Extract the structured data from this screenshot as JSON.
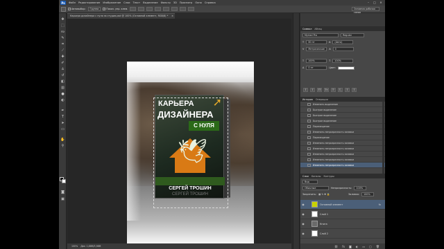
{
  "app": {
    "logo": "Ps"
  },
  "menu": [
    "Файл",
    "Редактирование",
    "Изображение",
    "Слои",
    "Текст",
    "Выделение",
    "Фильтр",
    "3D",
    "Просмотр",
    "Окно",
    "Справка"
  ],
  "window_controls": [
    "–",
    "□",
    "✕"
  ],
  "options": {
    "auto_select": "Автовыбор:",
    "auto_select_target": "Группа",
    "show_transform": "Показ. упр. элем.",
    "workspace": "Основная рабочая среда"
  },
  "document": {
    "tab_title": "Карьера дизайнера с нуля за студии.psd @ 100% (Основной элемент, RGB/8) *",
    "close": "×",
    "status": "100%",
    "status_doc": "Док: 1,88M/3,98M"
  },
  "book": {
    "title_line1": "КАРЬЕРА",
    "title_line2": "ДИЗАЙНЕРА",
    "subtitle": "С НУЛЯ",
    "author": "СЕРГЕЙ ТРОШИН",
    "author_mirror": "СЕРГЕЙ ТРОШИН"
  },
  "character_panel": {
    "tabs": [
      "Символ",
      "Абзац"
    ],
    "font": "Myriad Pro",
    "style": "Regular",
    "size": "30 пт",
    "leading": "(Авто)",
    "kerning": "Метрические",
    "tracking": "0",
    "v_scale": "100%",
    "h_scale": "100%",
    "baseline": "0 пт",
    "color_label": "Цвет:",
    "style_buttons": [
      "T",
      "T",
      "TT",
      "Tт",
      "T'",
      "T,",
      "T",
      "T"
    ]
  },
  "history_panel": {
    "tabs": [
      "История",
      "Операции"
    ],
    "items": [
      "Изменить выделение",
      "Быстрое выделение",
      "Быстрое выделение",
      "Быстрое выделение",
      "Перемещение",
      "Изменить непрозрачность заливки",
      "Перемещение",
      "Изменить непрозрачность заливки",
      "Изменить непрозрачность заливки",
      "Изменить непрозрачность заливки",
      "Изменить непрозрачность заливки",
      "Изменить непрозрачность заливки"
    ],
    "selected_index": 11
  },
  "layers_panel": {
    "tabs": [
      "Слои",
      "Каналы",
      "Контуры"
    ],
    "kind": "Вид",
    "blend_mode": "Обычные",
    "opacity_label": "Непрозрачность:",
    "opacity": "100%",
    "lock_label": "Закрепить:",
    "fill_label": "Заливка:",
    "fill": "100%",
    "layers": [
      {
        "name": "Основной элемент",
        "selected": true,
        "fx": "fx"
      },
      {
        "name": "Слой 1",
        "selected": false,
        "fx": ""
      },
      {
        "name": "Книга",
        "selected": false,
        "fx": ""
      },
      {
        "name": "Слой 2",
        "selected": false,
        "fx": ""
      }
    ],
    "bottom_icons": [
      "link-icon",
      "fx-icon",
      "mask-icon",
      "adjust-icon",
      "folder-icon",
      "new-layer-icon",
      "trash-icon"
    ]
  },
  "colors": {
    "accent": "#1a5bb5",
    "selected_row": "#4b5f78",
    "book_orange": "#d97a15",
    "book_green": "#2b6a18"
  }
}
